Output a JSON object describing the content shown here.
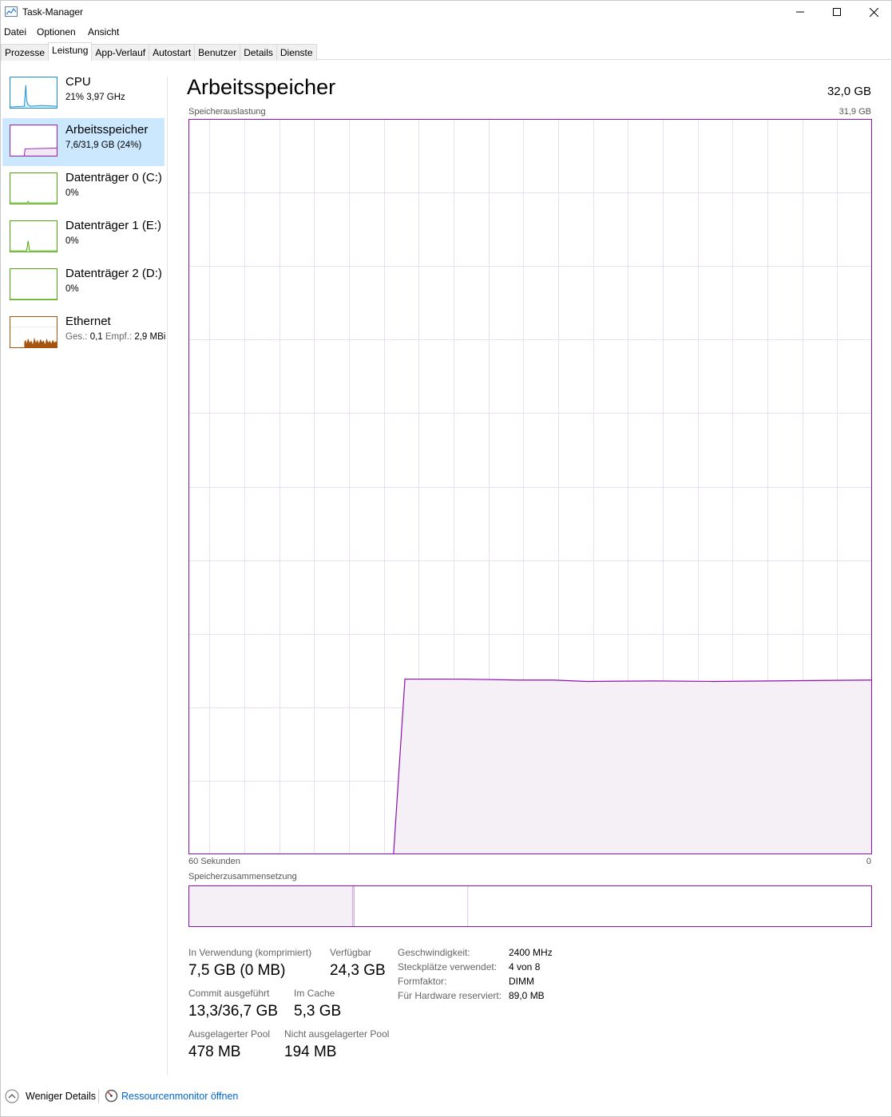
{
  "window": {
    "title": "Task-Manager",
    "controls": [
      "minimize",
      "maximize",
      "close"
    ]
  },
  "menu": [
    "Datei",
    "Optionen",
    "Ansicht"
  ],
  "tabs": [
    {
      "label": "Prozesse",
      "active": false
    },
    {
      "label": "Leistung",
      "active": true
    },
    {
      "label": "App-Verlauf",
      "active": false
    },
    {
      "label": "Autostart",
      "active": false
    },
    {
      "label": "Benutzer",
      "active": false
    },
    {
      "label": "Details",
      "active": false
    },
    {
      "label": "Dienste",
      "active": false
    }
  ],
  "sidebar": {
    "items": [
      {
        "title": "CPU",
        "sub": "21% 3,97 GHz",
        "color": "#1a8fd1"
      },
      {
        "title": "Arbeitsspeicher",
        "sub": "7,6/31,9 GB (24%)",
        "color": "#9b1fb0",
        "selected": true
      },
      {
        "title": "Datenträger 0 (C:)",
        "sub": "0%",
        "color": "#4da60c"
      },
      {
        "title": "Datenträger 1 (E:)",
        "sub": "0%",
        "color": "#4da60c"
      },
      {
        "title": "Datenträger 2 (D:)",
        "sub": "0%",
        "color": "#4da60c"
      },
      {
        "title": "Ethernet",
        "sub_label_send": "Ges.:",
        "sub_send": "0,1",
        "sub_label_recv": "Empf.:",
        "sub_recv": "2,9 MBi",
        "color": "#a75410"
      }
    ]
  },
  "main": {
    "title": "Arbeitsspeicher",
    "total": "32,0 GB",
    "graph_label": "Speicherauslastung",
    "graph_max": "31,9 GB",
    "time_left": "60 Sekunden",
    "time_right": "0",
    "composition_label": "Speicherzusammensetzung"
  },
  "stats": {
    "in_use_label": "In Verwendung (komprimiert)",
    "in_use_value": "7,5 GB (0 MB)",
    "available_label": "Verfügbar",
    "available_value": "24,3 GB",
    "commit_label": "Commit ausgeführt",
    "commit_value": "13,3/36,7 GB",
    "cache_label": "Im Cache",
    "cache_value": "5,3 GB",
    "paged_label": "Ausgelagerter Pool",
    "paged_value": "478 MB",
    "nonpaged_label": "Nicht ausgelagerter Pool",
    "nonpaged_value": "194 MB"
  },
  "details": [
    {
      "label": "Geschwindigkeit:",
      "value": "2400 MHz"
    },
    {
      "label": "Steckplätze verwendet:",
      "value": "4 von 8"
    },
    {
      "label": "Formfaktor:",
      "value": "DIMM"
    },
    {
      "label": "Für Hardware reserviert:",
      "value": "89,0 MB"
    }
  ],
  "footer": {
    "less_details": "Weniger Details",
    "resource_monitor": "Ressourcenmonitor öffnen"
  },
  "chart_data": {
    "type": "area",
    "x_unit": "seconds ago",
    "xlim": [
      60,
      0
    ],
    "ylim": [
      0,
      31.9
    ],
    "ylabel": "",
    "grid": true,
    "series": [
      {
        "color": "#8b12ae",
        "x": [
          60,
          42,
          41,
          36,
          31,
          28,
          25,
          19,
          14,
          0
        ],
        "y": [
          0,
          0,
          7.6,
          7.6,
          7.56,
          7.56,
          7.5,
          7.52,
          7.5,
          7.56
        ]
      }
    ],
    "composition": {
      "in_use_fraction": 0.24,
      "modified_fraction": 0.003,
      "standby_fraction": 0.166,
      "free_fraction": 0.591
    }
  }
}
